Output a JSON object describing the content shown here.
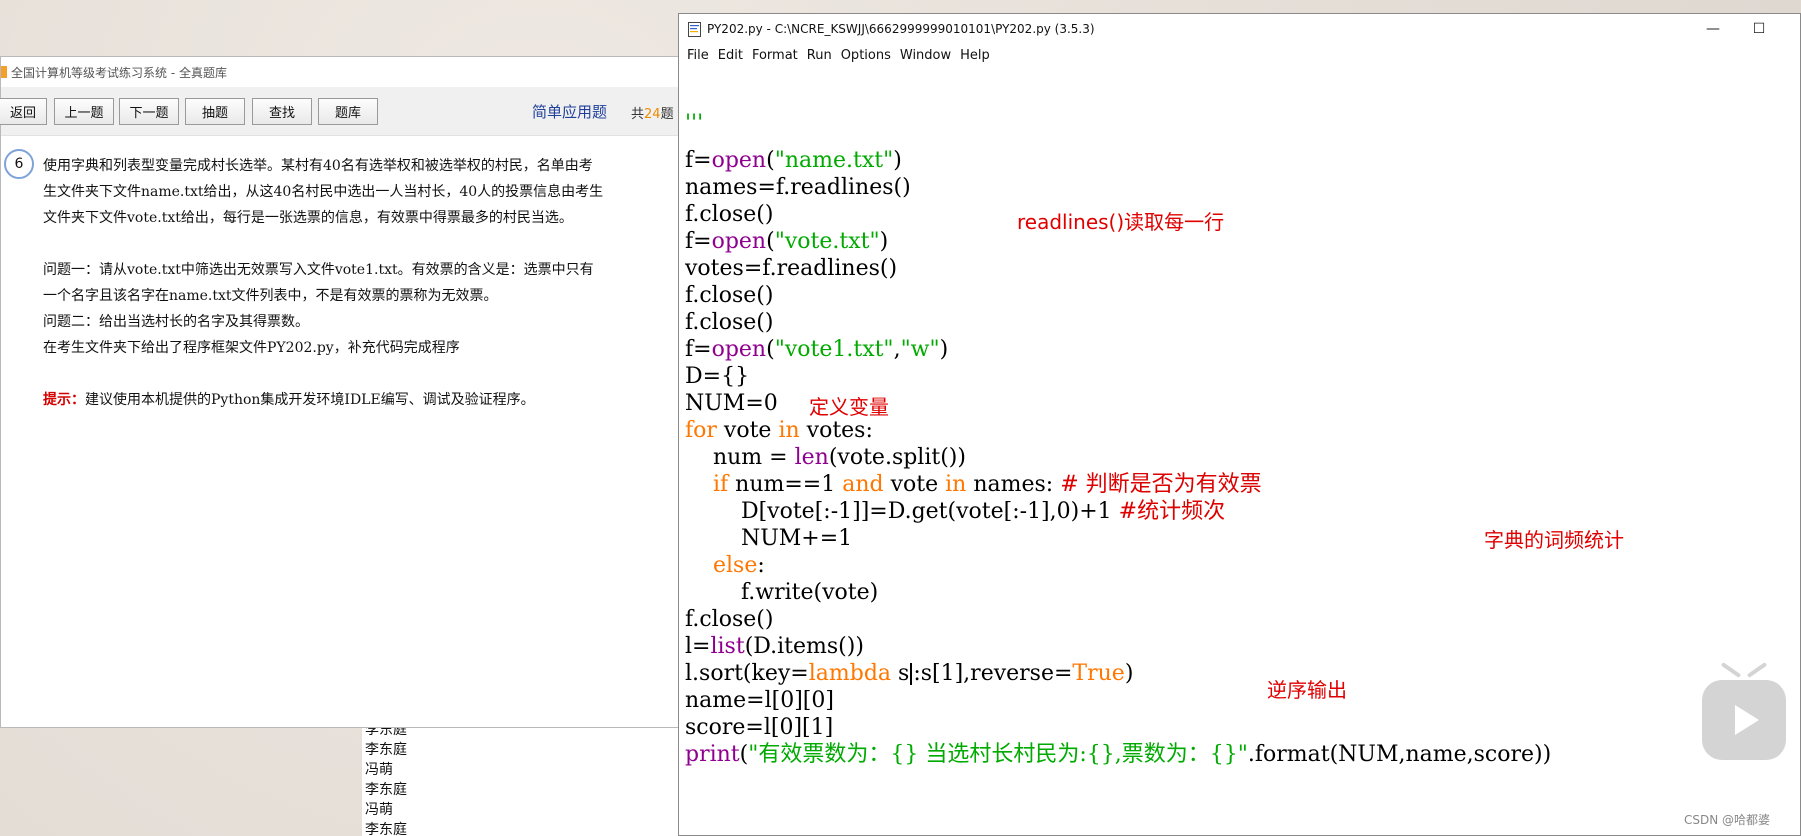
{
  "background_list": {
    "items": [
      "李东庭",
      "李东庭",
      "冯萌",
      "李东庭",
      "冯萌",
      "李东庭"
    ]
  },
  "exam_window": {
    "title": "全国计算机等级考试练习系统 - 全真题库",
    "toolbar": {
      "buttons": [
        "返回",
        "上一题",
        "下一题",
        "抽题",
        "查找",
        "题库"
      ],
      "question_type": "简单应用题",
      "count_prefix": "共",
      "count_num": "24",
      "count_suffix": "题"
    },
    "question": {
      "number": "6",
      "desc": [
        "使用字典和列表型变量完成村长选举。某村有40名有选举权和被选举权的村民，名单由考",
        "生文件夹下文件name.txt给出，从这40名村民中选出一人当村长，40人的投票信息由考生",
        "文件夹下文件vote.txt给出，每行是一张选票的信息，有效票中得票最多的村民当选。"
      ],
      "problem": [
        "问题一：请从vote.txt中筛选出无效票写入文件vote1.txt。有效票的含义是：选票中只有",
        "一个名字且该名字在name.txt文件列表中，不是有效票的票称为无效票。",
        "问题二：给出当选村长的名字及其得票数。",
        "在考生文件夹下给出了程序框架文件PY202.py，补充代码完成程序"
      ],
      "hint_label": "提示：",
      "hint_text": "建议使用本机提供的Python集成开发环境IDLE编写、调试及验证程序。"
    }
  },
  "idle_window": {
    "title": "PY202.py - C:\\NCRE_KSWJJ\\6662999999010101\\PY202.py (3.5.3)",
    "controls": {
      "minimize": "—",
      "maximize": "☐"
    },
    "menu": [
      "File",
      "Edit",
      "Format",
      "Run",
      "Options",
      "Window",
      "Help"
    ],
    "code": {
      "l0": "'''",
      "l1": "'''",
      "l2": {
        "a": "f=",
        "b": "open",
        "c": "(",
        "d": "\"name.txt\"",
        "e": ")"
      },
      "l3": "names=f.readlines()",
      "l4": "f.close()",
      "l5": {
        "a": "f=",
        "b": "open",
        "c": "(",
        "d": "\"vote.txt\"",
        "e": ")"
      },
      "l6": "votes=f.readlines()",
      "l7": "f.close()",
      "l8": "f.close()",
      "l9": {
        "a": "f=",
        "b": "open",
        "c": "(",
        "d": "\"vote1.txt\"",
        "e": ",",
        "f": "\"w\"",
        "g": ")"
      },
      "l10": "D={}",
      "l11": "NUM=0",
      "l12": {
        "kw1": "for",
        "a": " vote ",
        "kw2": "in",
        "b": " votes:"
      },
      "l13": {
        "a": "    num = ",
        "bi": "len",
        "b": "(vote.split())"
      },
      "l14": {
        "pre": "    ",
        "kw1": "if",
        "a": " num==1 ",
        "kw2": "and",
        "b": " vote ",
        "kw3": "in",
        "c": " names: ",
        "cm": "# 判断是否为有效票"
      },
      "l15": {
        "a": "        D[vote[:-1]]=D.get(vote[:-1],0)+1 ",
        "cm": "#统计频次"
      },
      "l16": "        NUM+=1",
      "l17": {
        "pre": "    ",
        "kw": "else",
        "a": ":"
      },
      "l18": "        f.write(vote)",
      "l19": "f.close()",
      "l20": {
        "a": "l=",
        "bi": "list",
        "b": "(D.items())"
      },
      "l21": {
        "a": "l.sort(key=",
        "kw1": "lambda",
        "b": " s",
        "c": ":s[1],reverse=",
        "kw2": "True",
        "d": ")"
      },
      "l22": "name=l[0][0]",
      "l23": "score=l[0][1]",
      "l24": {
        "bi": "print",
        "a": "(",
        "str": "\"有效票数为：{} 当选村长村民为:{},票数为：{}\"",
        "b": ".format(NUM,name,score))"
      }
    },
    "annotations": {
      "readlines": "readlines()读取每一行",
      "define_var": "定义变量",
      "dict_freq": "字典的词频统计",
      "reverse_out": "逆序输出"
    }
  },
  "watermark": "CSDN @哈都婆"
}
